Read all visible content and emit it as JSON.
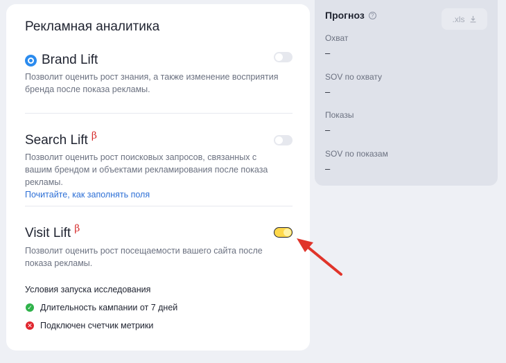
{
  "card": {
    "title": "Рекламная аналитика",
    "brand_lift": {
      "title": "Brand Lift",
      "description": "Позволит оценить рост знания, а также изменение восприятия бренда после показа рекламы.",
      "enabled": false
    },
    "search_lift": {
      "title": "Search Lift",
      "beta": "β",
      "description": "Позволит оценить рост поисковых запросов, связанных с вашим брендом и объектами рекламирования после показа рекламы.",
      "link": "Почитайте, как заполнять поля",
      "enabled": false
    },
    "visit_lift": {
      "title": "Visit Lift",
      "beta": "β",
      "description": "Позволит оценить рост посещаемости вашего сайта после показа рекламы.",
      "enabled": true
    },
    "conditions": {
      "title": "Условия запуска исследования",
      "items": [
        {
          "label": "Длительность кампании от 7 дней",
          "status": "ok",
          "icon": "check-icon"
        },
        {
          "label": "Подключен счетчик метрики",
          "status": "fail",
          "icon": "cross-icon"
        }
      ]
    }
  },
  "forecast": {
    "title": "Прогноз",
    "export_label": ".xls",
    "metrics": [
      {
        "label": "Охват",
        "value": "–"
      },
      {
        "label": "SOV по охвату",
        "value": "–"
      },
      {
        "label": "Показы",
        "value": "–"
      },
      {
        "label": "SOV по показам",
        "value": "–"
      }
    ]
  },
  "colors": {
    "accent_toggle": "#ffd84a",
    "link": "#2c6fd6",
    "beta": "#d62b2b",
    "ok": "#2fb24a",
    "fail": "#e0262e",
    "annotation_arrow": "#e0342a"
  }
}
